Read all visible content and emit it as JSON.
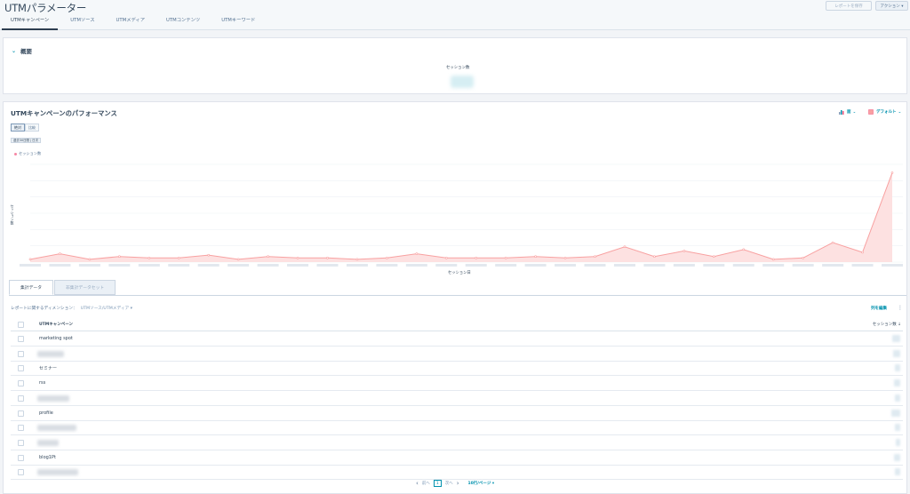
{
  "header": {
    "title": "UTMパラメーター",
    "save_report_label": "レポートを保存",
    "actions_label": "アクション ▾",
    "tabs": [
      "UTMキャンペーン",
      "UTMソース",
      "UTMメディア",
      "UTMコンテンツ",
      "UTMキーワード"
    ]
  },
  "summary": {
    "title": "概要",
    "sessions_label": "セッション数"
  },
  "performance": {
    "title": "UTMキャンペーンのパフォーマンス",
    "chart_type_label": "面",
    "style_label": "デフォルト",
    "toggle": [
      "絶対",
      "比較"
    ],
    "date_chip": "過去30日間 | 日次",
    "legend": "セッション数",
    "y_label": "セッション数",
    "x_title": "セッション日"
  },
  "chart_data": {
    "type": "area",
    "title": "",
    "xlabel": "セッション日",
    "ylabel": "セッション数",
    "series": [
      {
        "name": "セッション数",
        "values": [
          1,
          3,
          1,
          2,
          1.5,
          1.5,
          2.5,
          1,
          2,
          1.5,
          1.5,
          1,
          1.5,
          3,
          1.5,
          1.5,
          1.5,
          2,
          1.5,
          2,
          5.5,
          2,
          4,
          2,
          4.5,
          1,
          1.5,
          7,
          3.5,
          32
        ]
      }
    ],
    "ylim": [
      0,
      35
    ],
    "grid": true,
    "color": "#f8a1a1"
  },
  "table": {
    "tabs": [
      "集計データ",
      "非集計データセット"
    ],
    "dimension_prefix": "レポートに関するディメンション：",
    "dimension_value": "UTMソース/UTMメディア ▾",
    "edit_columns": "列を編集",
    "col_campaign": "UTMキャンペーン",
    "col_sessions": "セッション数 ↓",
    "rows": [
      {
        "label": "marketing spot"
      },
      {
        "label": ""
      },
      {
        "label": "セミナー"
      },
      {
        "label": "rss"
      },
      {
        "label": ""
      },
      {
        "label": "profile"
      },
      {
        "label": ""
      },
      {
        "label": ""
      },
      {
        "label": "blog1Pt"
      },
      {
        "label": ""
      }
    ]
  },
  "pagination": {
    "prev": "前へ",
    "page": "1",
    "next": "次へ",
    "page_size": "10行/ページ ▾"
  }
}
